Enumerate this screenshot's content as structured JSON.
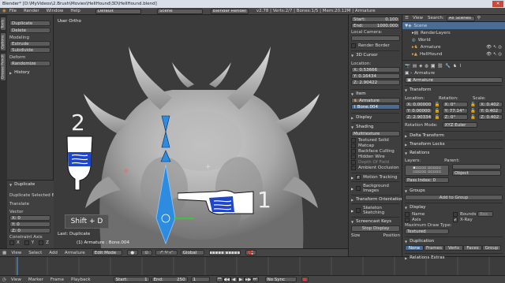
{
  "window_title": "Blender* [D:\\MyVideos\\2.Brush\\Movies\\HellHound\\3D\\HellHound.blend]",
  "topbar": {
    "menus": [
      "File",
      "Render",
      "Window",
      "Help"
    ],
    "layout": "Default",
    "scene": "Scene",
    "engine": "Blender Render",
    "stats": "v2.78 | Verts:2/7 | Bones:1/5 | Mem:20.12M | Armature"
  },
  "toolshelf": {
    "tabs": [
      "Tools",
      "Options",
      "Grease Pencil"
    ],
    "top_buttons": [
      "Duplicate",
      "Delete"
    ],
    "labels": [
      "Modeling",
      "Randomize",
      "Deform"
    ],
    "buttons": [
      "Extrude",
      "Subdivide",
      "Randomize"
    ],
    "history": "History",
    "op_panel": {
      "title": "Duplicate",
      "subtitle": "Duplicate Selected Bo...",
      "translate": "Translate",
      "vector": "Vector",
      "x": "X: 0",
      "y": "Y: 0",
      "z": "Z: 0",
      "constraint": "Constraint Axis",
      "axes": [
        "X",
        "Y",
        "Z"
      ]
    }
  },
  "viewport": {
    "label": "User Ortho",
    "status": "(1) Armature : Bone.004",
    "last_op": "Last: Duplicate",
    "shortcut": "Shift + D",
    "annot1": "1",
    "annot2": "2"
  },
  "viewport_header": {
    "menus": [
      "View",
      "Select",
      "Add",
      "Armature"
    ],
    "mode": "Edit Mode",
    "orientation": "Global"
  },
  "npanel": {
    "start_lbl": "Start:",
    "start_val": "0.100",
    "end_lbl": "End:",
    "end_val": "1000.000",
    "local_cameras": "Local Camera:",
    "render_border": "Render Border",
    "cursor_title": "3D Cursor",
    "location": "Location:",
    "cx": "X: 0.53666",
    "cy": "Y: 0.16434",
    "cz": "Z: 2.90422",
    "item_title": "Item",
    "item_name": "Armature",
    "bone_name": "Bone.004",
    "display": "Display",
    "shading": "Shading",
    "multitexture": "Multitexture",
    "shading_opts": [
      "Textured Solid",
      "Matcap",
      "Backface Culling",
      "Hidden Wire",
      "Depth Of Field",
      "Ambient Occlusion"
    ],
    "motion_tracking": "Motion Tracking",
    "bg_images": "Background Images",
    "transform_orient": "Transform Orientations",
    "skeleton": "Skeleton Sketching",
    "screencast": "Screencast Keys",
    "stop_display": "Stop Display",
    "size": "Size",
    "position": "Position"
  },
  "outliner": {
    "menus": [
      "View",
      "Search:"
    ],
    "filter": "All Scenes",
    "items": [
      "Scene",
      "RenderLayers",
      "World",
      "Armature",
      "HellHound"
    ]
  },
  "properties": {
    "object": "Armature",
    "object_field": "Armature",
    "transform": "Transform",
    "location": "Location:",
    "rotation": "Rotation:",
    "scale": "Scale:",
    "loc": [
      "X: 0.00000",
      "Y: 0.00000",
      "Z: 2.90334"
    ],
    "rot": [
      "X: 0°",
      "Y: 77.14°",
      "Z: 0°"
    ],
    "scl": [
      "X: 0.402",
      "Y: 0.402",
      "Z: 0.402"
    ],
    "rot_mode_lbl": "Rotation Mode:",
    "rot_mode": "XYZ Euler",
    "delta": "Delta Transform",
    "locks": "Transform Locks",
    "relations": "Relations",
    "layers": "Layers:",
    "parent": "Parent:",
    "object_lbl": "Object",
    "pass_index": "Pass Index: 0",
    "groups": "Groups",
    "add_to_group": "Add to Group",
    "display": "Display",
    "name": "Name",
    "bounds": "Bounds",
    "box": "Box",
    "axis": "Axis",
    "xray": "X-Ray",
    "max_draw": "Maximum Draw Type:",
    "textured": "Textured",
    "duplication": "Duplication",
    "dup_tabs": [
      "None",
      "Frames",
      "Verts",
      "Faces",
      "Group"
    ],
    "extras": "Relations Extras"
  },
  "timeline": {
    "menus": [
      "View",
      "Marker",
      "Frame",
      "Playback"
    ],
    "start": "Start:",
    "start_v": "1",
    "end": "End:",
    "end_v": "250",
    "cur": "1",
    "sync": "No Sync"
  },
  "colors": {
    "accent": "#4a6d96",
    "bone": "#2d8be0",
    "hand_cuff": "#1e46c8"
  }
}
